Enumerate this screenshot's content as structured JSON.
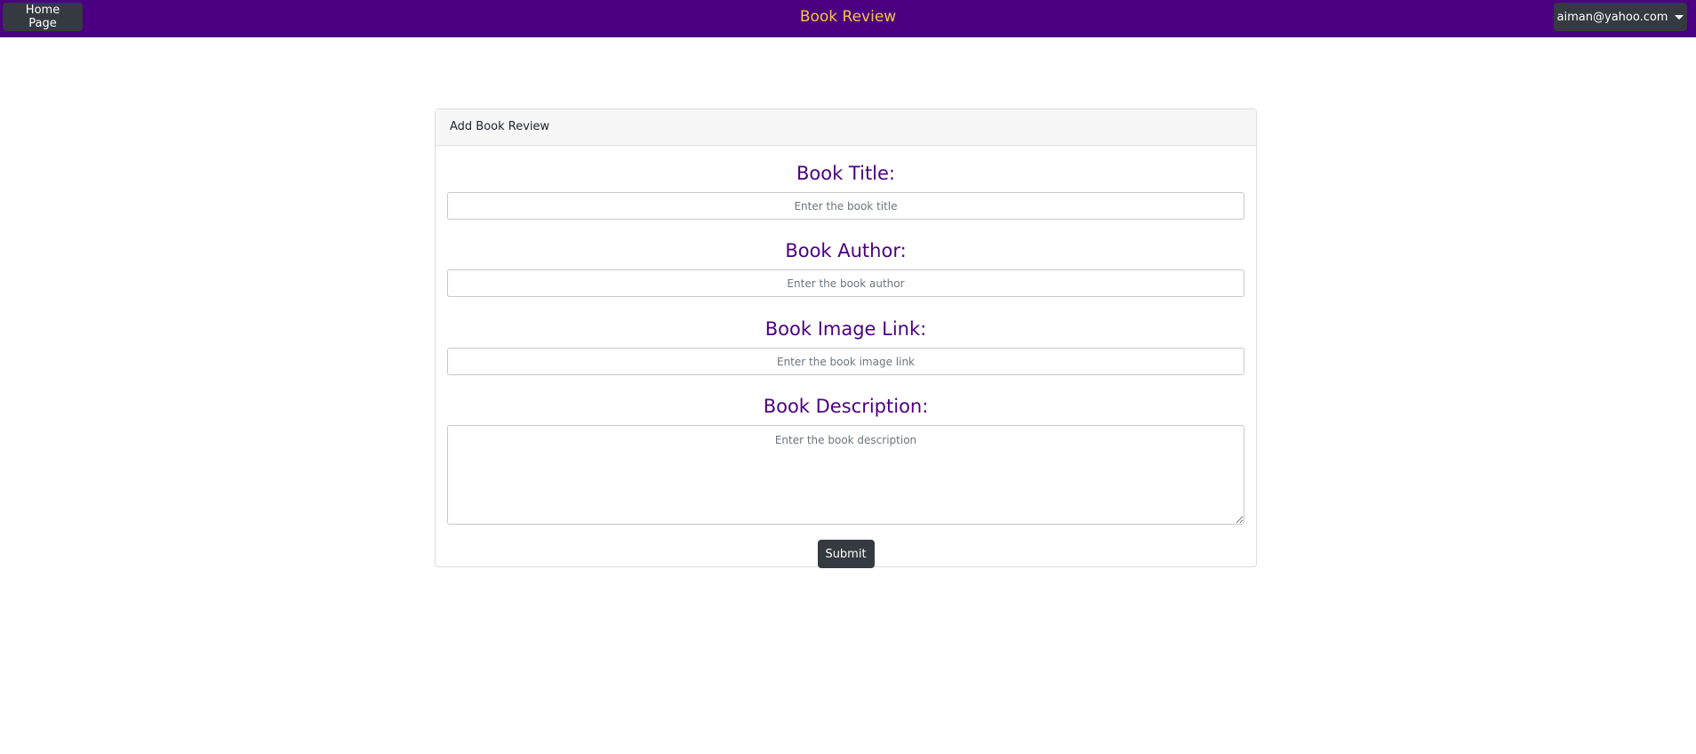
{
  "navbar": {
    "home_label": "Home Page",
    "brand": "Book Review",
    "user_email": "aiman@yahoo.com",
    "background": "#4b0082",
    "brand_color": "#f5c542"
  },
  "card": {
    "header": "Add Book Review",
    "fields": [
      {
        "label": "Book Title:",
        "placeholder": "Enter the book title"
      },
      {
        "label": "Book Author:",
        "placeholder": "Enter the book author"
      },
      {
        "label": "Book Image Link:",
        "placeholder": "Enter the book image link"
      },
      {
        "label": "Book Description:",
        "placeholder": "Enter the book description"
      }
    ],
    "submit_label": "Submit",
    "label_color": "#4b0082",
    "button_color": "#343a40"
  }
}
